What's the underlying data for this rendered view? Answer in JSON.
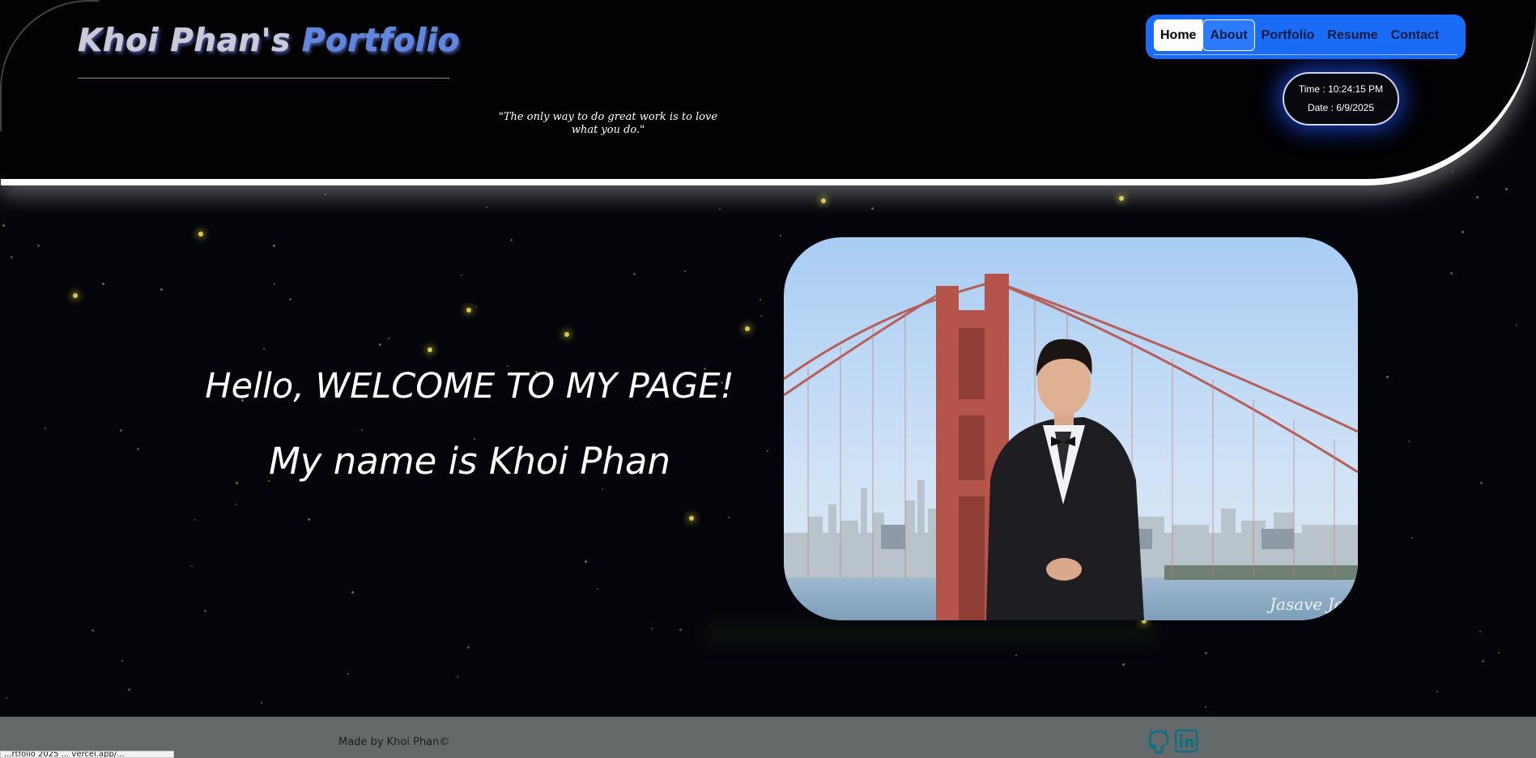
{
  "header": {
    "title_part1": "Khoi Phan's ",
    "title_part2": "Portfolio",
    "quote": "\"The only way to do great work is to love what you do.\""
  },
  "nav": {
    "items": [
      {
        "label": "Home",
        "state": "active"
      },
      {
        "label": "About",
        "state": "hover"
      },
      {
        "label": "Portfolio",
        "state": "normal"
      },
      {
        "label": "Resume",
        "state": "normal"
      },
      {
        "label": "Contact",
        "state": "normal"
      }
    ]
  },
  "clock": {
    "time": "Time : 10:24:15 PM",
    "date": "Date : 6/9/2025"
  },
  "hero": {
    "greeting": "Hello, WELCOME TO MY PAGE!",
    "name_line": "My name is Khoi Phan",
    "photo": {
      "subject": "man in tuxedo in front of Golden Gate Bridge",
      "watermark": "Jasave Jos"
    }
  },
  "footer": {
    "credit": "Made by Khoi Phan©",
    "social": [
      {
        "icon": "github-icon"
      },
      {
        "icon": "linkedin-icon"
      }
    ],
    "status_url": "...rtfolio 2025 ... vercel.app/..."
  },
  "colors": {
    "nav_bg": "#1a6cf7",
    "title_accent": "#5f86e0",
    "footer_bg": "#646a69",
    "social_icon": "#0e6f86",
    "background": "#04050a"
  }
}
